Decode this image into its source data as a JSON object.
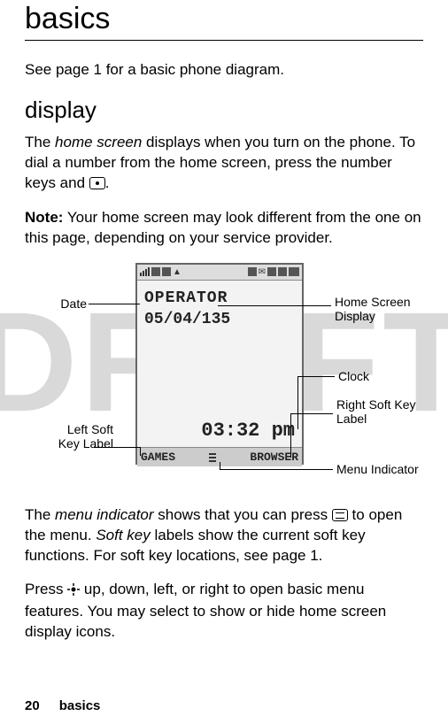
{
  "watermark": "DRAFT",
  "title": "basics",
  "intro": "See page 1 for a basic phone diagram.",
  "section_display": "display",
  "para1_pre": "The ",
  "para1_italic": "home screen",
  "para1_post": " displays when you turn on the phone. To dial a number from the home screen, press the number keys and ",
  "para1_end": ".",
  "note_label": "Note:",
  "note_text": " Your home screen may look different from the one on this page, depending on your service provider.",
  "phone": {
    "operator": "OPERATOR",
    "date": "05/04/135",
    "clock": "03:32 pm",
    "left_soft": "GAMES",
    "right_soft": "BROWSER"
  },
  "callouts": {
    "date": "Date",
    "home_screen_display_l1": "Home Screen",
    "home_screen_display_l2": "Display",
    "clock": "Clock",
    "right_soft_l1": "Right Soft Key",
    "right_soft_l2": "Label",
    "left_soft_l1": "Left Soft",
    "left_soft_l2": "Key Label",
    "menu_indicator": "Menu Indicator"
  },
  "para2_pre": "The ",
  "para2_italic1": "menu indicator",
  "para2_mid1": " shows that you can press ",
  "para2_mid2": " to open the menu. ",
  "para2_italic2": "Soft key",
  "para2_post": " labels show the current soft key functions. For soft key locations, see page 1.",
  "para3_pre": "Press ",
  "para3_post": " up, down, left, or right to open basic menu features. You may select to show or hide home screen display icons.",
  "footer": {
    "page": "20",
    "section": "basics"
  }
}
